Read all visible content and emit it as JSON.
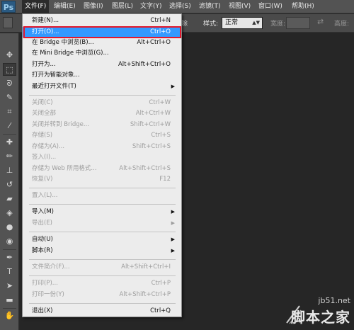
{
  "app": {
    "logo_text": "Ps",
    "accent_color": "#3399ff",
    "highlight_border_color": "#e3182c"
  },
  "menubar": {
    "items": [
      {
        "label": "文件(F)",
        "active": true
      },
      {
        "label": "编辑(E)"
      },
      {
        "label": "图像(I)"
      },
      {
        "label": "图层(L)"
      },
      {
        "label": "文字(Y)"
      },
      {
        "label": "选择(S)"
      },
      {
        "label": "滤镜(T)"
      },
      {
        "label": "视图(V)"
      },
      {
        "label": "窗口(W)"
      },
      {
        "label": "帮助(H)"
      }
    ]
  },
  "options": {
    "antialias_label": "除",
    "style_label": "样式:",
    "style_value": "正常",
    "width_label": "宽度:",
    "height_label": "高度:"
  },
  "file_menu": {
    "items": [
      {
        "label": "新建(N)...",
        "shortcut": "Ctrl+N"
      },
      {
        "label": "打开(O)...",
        "shortcut": "Ctrl+O",
        "highlighted": true
      },
      {
        "label": "在 Bridge 中浏览(B)...",
        "shortcut": "Alt+Ctrl+O"
      },
      {
        "label": "在 Mini Bridge 中浏览(G)...",
        "shortcut": ""
      },
      {
        "label": "打开为...",
        "shortcut": "Alt+Shift+Ctrl+O"
      },
      {
        "label": "打开为智能对象...",
        "shortcut": ""
      },
      {
        "label": "最近打开文件(T)",
        "shortcut": "",
        "submenu": true
      },
      {
        "label": "关闭(C)",
        "shortcut": "Ctrl+W",
        "disabled": true
      },
      {
        "label": "关闭全部",
        "shortcut": "Alt+Ctrl+W",
        "disabled": true
      },
      {
        "label": "关闭并转到 Bridge...",
        "shortcut": "Shift+Ctrl+W",
        "disabled": true
      },
      {
        "label": "存储(S)",
        "shortcut": "Ctrl+S",
        "disabled": true
      },
      {
        "label": "存储为(A)...",
        "shortcut": "Shift+Ctrl+S",
        "disabled": true
      },
      {
        "label": "签入(I)...",
        "shortcut": "",
        "disabled": true
      },
      {
        "label": "存储为 Web 所用格式...",
        "shortcut": "Alt+Shift+Ctrl+S",
        "disabled": true
      },
      {
        "label": "恢复(V)",
        "shortcut": "F12",
        "disabled": true
      },
      {
        "label": "置入(L)...",
        "shortcut": "",
        "disabled": true
      },
      {
        "label": "导入(M)",
        "shortcut": "",
        "submenu": true
      },
      {
        "label": "导出(E)",
        "shortcut": "",
        "submenu": true,
        "disabled": true
      },
      {
        "label": "自动(U)",
        "shortcut": "",
        "submenu": true
      },
      {
        "label": "脚本(R)",
        "shortcut": "",
        "submenu": true
      },
      {
        "label": "文件简介(F)...",
        "shortcut": "Alt+Shift+Ctrl+I",
        "disabled": true
      },
      {
        "label": "打印(P)...",
        "shortcut": "Ctrl+P",
        "disabled": true
      },
      {
        "label": "打印一份(Y)",
        "shortcut": "Alt+Shift+Ctrl+P",
        "disabled": true
      },
      {
        "label": "退出(X)",
        "shortcut": "Ctrl+Q"
      }
    ]
  },
  "watermark": {
    "url": "jb51.net",
    "name": "脚本之家"
  }
}
